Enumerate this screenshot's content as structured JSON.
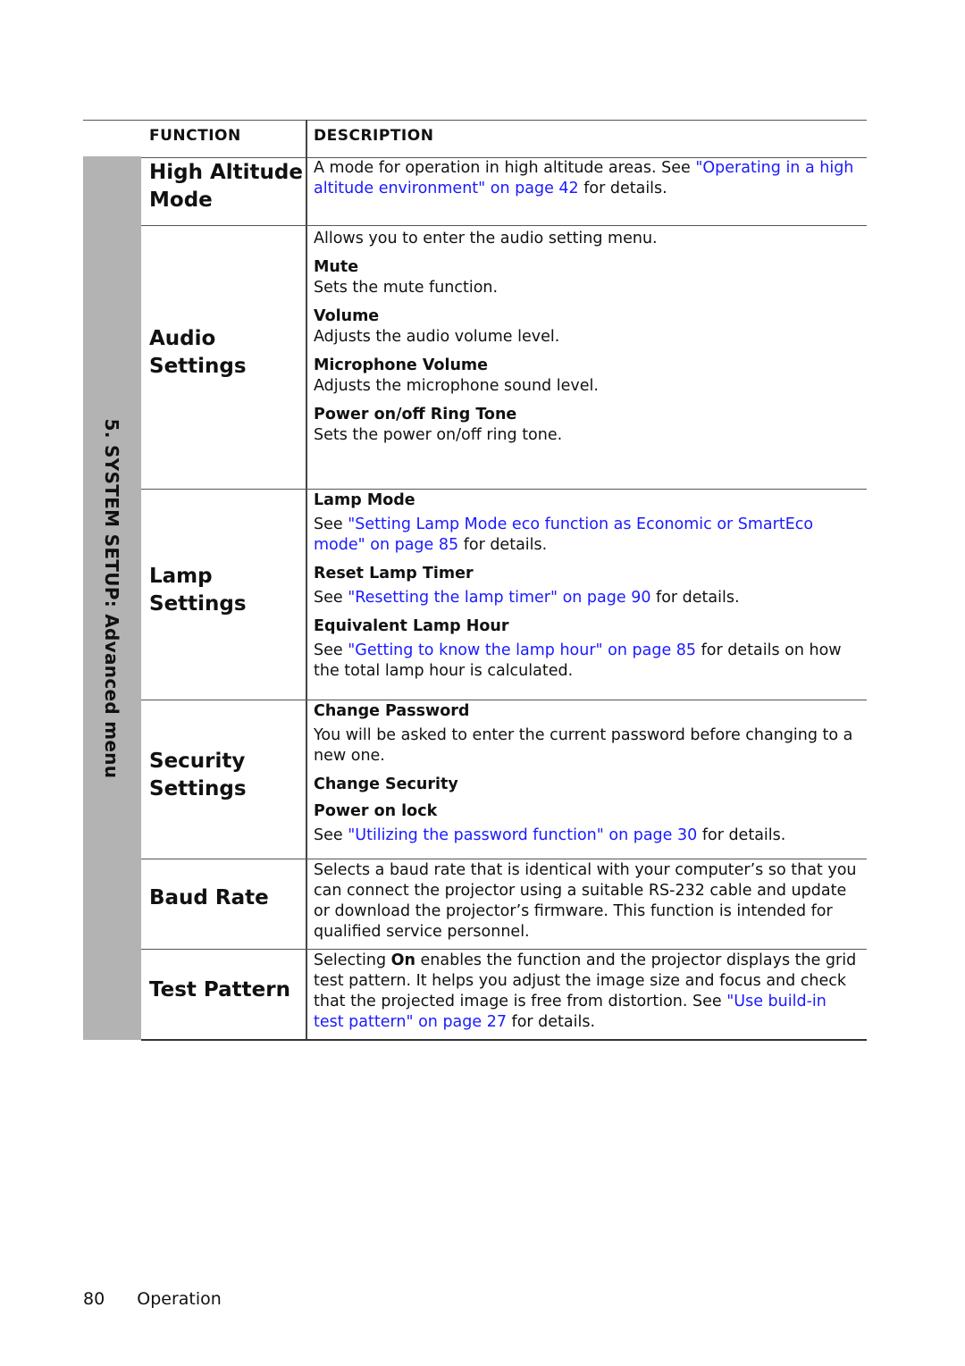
{
  "header": {
    "function_label": "FUNCTION",
    "description_label": "DESCRIPTION"
  },
  "side_label": "5. SYSTEM SETUP: Advanced menu",
  "rows": {
    "high_altitude": {
      "function_line1": "High Altitude",
      "function_line2": "Mode",
      "desc_pre": "A mode for operation in high altitude areas. See ",
      "desc_link": "\"Operating in a high altitude environment\" on page 42",
      "desc_post": " for details."
    },
    "audio": {
      "function_line1": "Audio",
      "function_line2": "Settings",
      "intro": "Allows you to enter the audio setting menu.",
      "items": [
        {
          "title": "Mute",
          "text": "Sets the mute function."
        },
        {
          "title": "Volume",
          "text": "Adjusts the audio volume level."
        },
        {
          "title": "Microphone Volume",
          "text": "Adjusts the microphone sound level."
        },
        {
          "title": "Power on/off Ring Tone",
          "text": "Sets the power on/off ring tone."
        }
      ]
    },
    "lamp": {
      "function_line1": "Lamp",
      "function_line2": "Settings",
      "items": [
        {
          "title": "Lamp Mode",
          "pre": "See ",
          "link": "\"Setting Lamp Mode eco function as Economic or SmartEco mode\" on page 85",
          "post": " for details."
        },
        {
          "title": "Reset Lamp Timer",
          "pre": "See ",
          "link": "\"Resetting the lamp timer\" on page 90",
          "post": " for details."
        },
        {
          "title": "Equivalent Lamp Hour",
          "pre": "See ",
          "link": "\"Getting to know the lamp hour\" on page 85",
          "post": " for details on how the total lamp hour is calculated."
        }
      ]
    },
    "security": {
      "function_line1": "Security",
      "function_line2": "Settings",
      "change_password_title": "Change Password",
      "change_password_text": "You will be asked to enter the current password before changing to a new one.",
      "change_security_title": "Change Security",
      "power_on_lock_title": "Power on lock",
      "pre": "See ",
      "link": "\"Utilizing the password function\" on page 30",
      "post": " for details."
    },
    "baud_rate": {
      "function_label": "Baud Rate",
      "text": "Selects a baud rate that is identical with your computer’s so that you can connect the projector using a suitable RS-232 cable and update or download the projector’s firmware. This function is intended for qualified service personnel."
    },
    "test_pattern": {
      "function_label": "Test Pattern",
      "pre": "Selecting ",
      "bold": "On",
      "mid": " enables the function and the projector displays the grid test pattern. It helps you adjust the image size and focus and check that the projected image is free from distortion. See ",
      "link": "\"Use build-in test pattern\" on page 27",
      "post": " for details."
    }
  },
  "footer": {
    "page_number": "80",
    "section": "Operation"
  },
  "colors": {
    "link": "#1a1aff",
    "sidebar": "#b3b3b3"
  }
}
